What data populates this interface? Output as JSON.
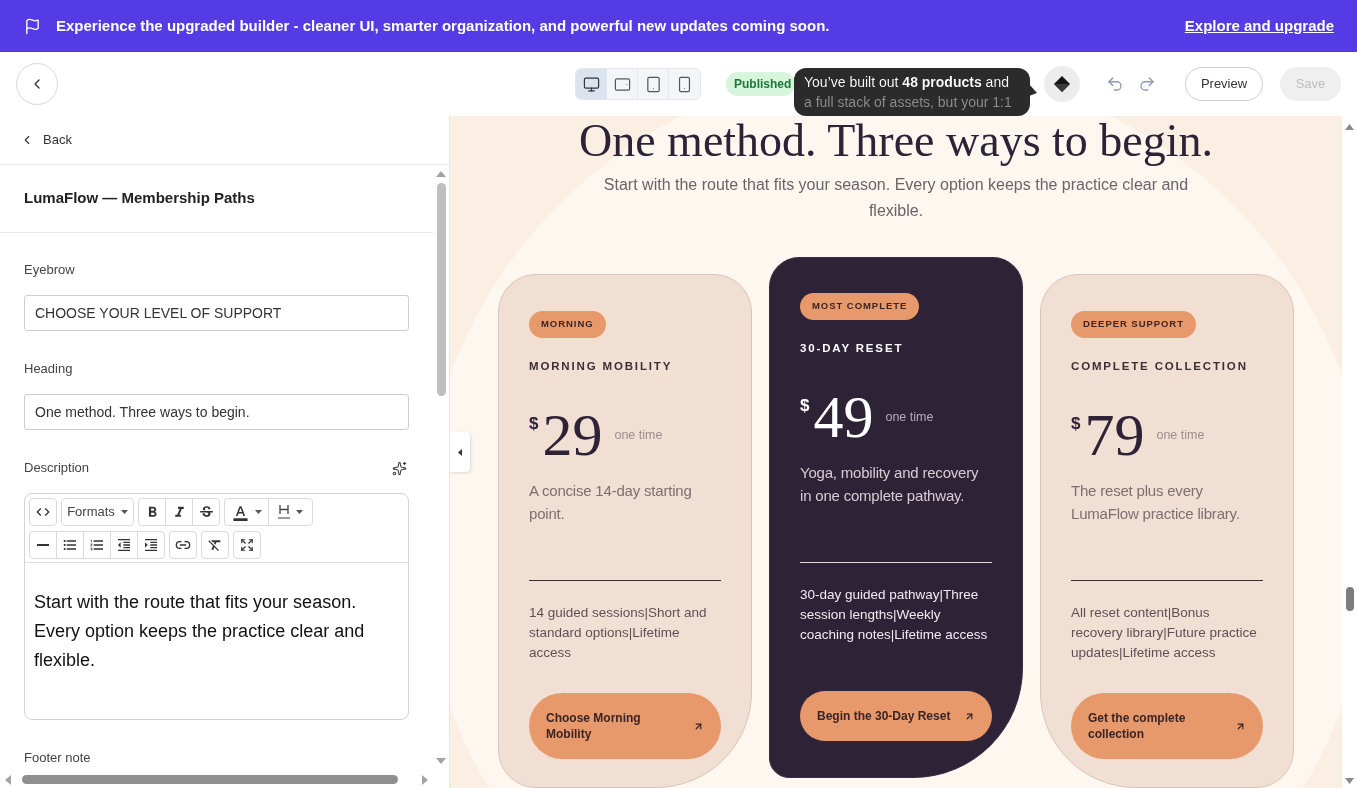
{
  "banner": {
    "text": "Experience the upgraded builder - cleaner UI, smarter organization, and powerful new updates coming soon.",
    "link": "Explore and upgrade"
  },
  "toolbar": {
    "device_modes": [
      {
        "kind": "desktop",
        "selected": true
      },
      {
        "kind": "tablet_landscape",
        "selected": false
      },
      {
        "kind": "tablet",
        "selected": false
      },
      {
        "kind": "mobile",
        "selected": false
      }
    ],
    "status": "Published",
    "tooltip": "You’ve built out **48 products** and a full stack of assets, but your 1:1",
    "actions": [
      {
        "kind": "outline",
        "label": "Preview",
        "disabled": false
      },
      {
        "kind": "primary",
        "label": "Save",
        "disabled": true
      }
    ]
  },
  "sidebar": {
    "back": "Back",
    "title": "LumaFlow — Membership Paths",
    "fields": [
      {
        "kind": "input",
        "label": "Eyebrow",
        "value": "CHOOSE YOUR LEVEL OF SUPPORT"
      },
      {
        "kind": "input",
        "label": "Heading",
        "value": "One method. Three ways to begin."
      },
      {
        "kind": "rich_text",
        "label": "Description",
        "format_menu": "Formats",
        "value": "Start with the route that fits your season. Every option keeps the practice clear and flexible."
      },
      {
        "kind": "label",
        "label": "Footer note"
      }
    ]
  },
  "canvas": {
    "heading": "One method. Three ways to begin.",
    "subheading": "Start with the route that fits your season. Every option keeps the practice clear and flexible.",
    "plans": [
      {
        "featured": false,
        "badge": "MORNING",
        "name": "MORNING MOBILITY",
        "currency": "$",
        "price": "29",
        "period": "one time",
        "description": "A concise 14-day starting point.",
        "features": "14 guided sessions|Short and standard options|Lifetime access",
        "cta": "Choose Morning Mobility"
      },
      {
        "featured": true,
        "badge": "MOST COMPLETE",
        "name": "30-DAY RESET",
        "currency": "$",
        "price": "49",
        "period": "one time",
        "description": "Yoga, mobility and recovery in one complete pathway.",
        "features": "30-day guided pathway|Three session lengths|Weekly coaching notes|Lifetime access",
        "cta": "Begin the 30-Day Reset"
      },
      {
        "featured": false,
        "badge": "DEEPER SUPPORT",
        "name": "COMPLETE COLLECTION",
        "currency": "$",
        "price": "79",
        "period": "one time",
        "description": "The reset plus every LumaFlow practice library.",
        "features": "All reset content|Bonus recovery library|Future practice updates|Lifetime access",
        "cta": "Get the complete collection"
      }
    ]
  }
}
